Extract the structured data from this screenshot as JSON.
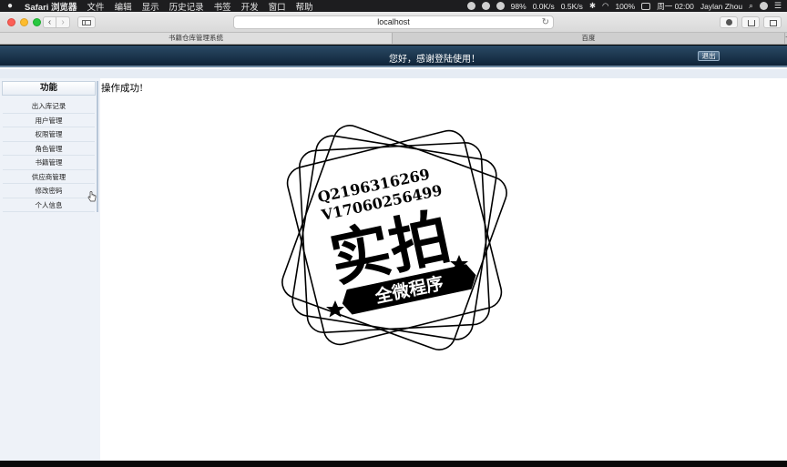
{
  "menubar": {
    "app_name": "Safari 浏览器",
    "items": [
      "文件",
      "编辑",
      "显示",
      "历史记录",
      "书签",
      "开发",
      "窗口",
      "帮助"
    ],
    "status": {
      "network_up": "0.0K/s",
      "network_down": "0.5K/s",
      "battery_left": "98%",
      "battery": "100%",
      "datetime": "周一 02:00",
      "user": "Jaylan Zhou"
    }
  },
  "browser": {
    "url": "localhost",
    "tabs": [
      {
        "label": "书籍仓库管理系统",
        "active": true
      },
      {
        "label": "百度",
        "active": false
      }
    ],
    "add_tab": "+"
  },
  "header": {
    "welcome": "您好，感谢登陆使用！",
    "logout_label": "退出"
  },
  "sidebar": {
    "title": "功能",
    "items": [
      {
        "label": "出入库记录"
      },
      {
        "label": "用户管理"
      },
      {
        "label": "权限管理"
      },
      {
        "label": "角色管理"
      },
      {
        "label": "书籍管理"
      },
      {
        "label": "供应商管理"
      },
      {
        "label": "修改密码"
      },
      {
        "label": "个人信息"
      }
    ]
  },
  "content": {
    "message": "操作成功!"
  },
  "watermark": {
    "line1": "Q2196316269",
    "line2": "V17060256499",
    "big_text": "实拍",
    "ribbon_text": "全微程序"
  },
  "colors": {
    "header_bg": "#1b3550",
    "sidebar_bg": "#eef2f8"
  }
}
